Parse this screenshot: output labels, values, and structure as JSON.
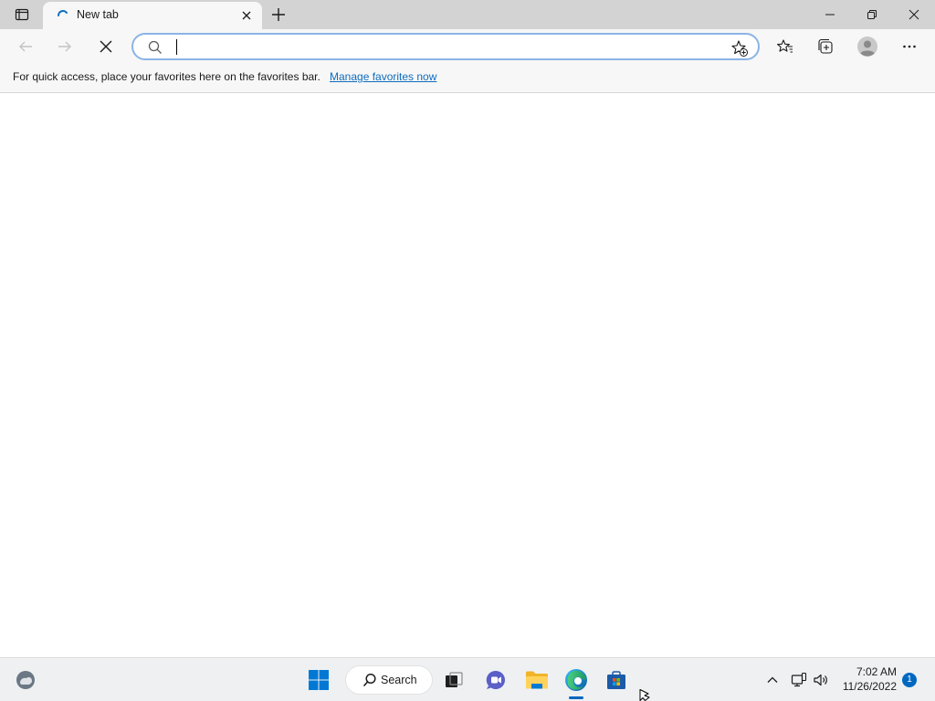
{
  "browser": {
    "tab": {
      "title": "New tab"
    },
    "address_bar": {
      "value": "",
      "placeholder": ""
    },
    "favorites_bar": {
      "message": "For quick access, place your favorites here on the favorites bar.",
      "link_label": "Manage favorites now"
    }
  },
  "taskbar": {
    "search_label": "Search",
    "clock": {
      "time": "7:02 AM",
      "date": "11/26/2022"
    },
    "notification_count": "1"
  },
  "icons": {
    "tab_actions": "tab-actions-icon",
    "tab_loading": "loading-spinner-icon",
    "close": "close-icon",
    "new_tab": "plus-icon",
    "minimize": "minimize-icon",
    "restore": "restore-icon",
    "window_close": "close-icon",
    "back": "back-arrow-icon",
    "forward": "forward-arrow-icon",
    "stop": "stop-icon",
    "search": "search-icon",
    "add_favorite": "star-add-icon",
    "favorites": "favorites-icon",
    "collections": "collections-icon",
    "profile": "profile-icon",
    "more": "more-icon",
    "weather": "weather-icon",
    "start": "windows-start-icon",
    "task_view": "task-view-icon",
    "chat": "chat-icon",
    "file_explorer": "folder-icon",
    "edge": "edge-icon",
    "store": "store-icon",
    "tray_chevron": "chevron-up-icon",
    "network": "network-icon",
    "volume": "volume-icon"
  },
  "colors": {
    "accent": "#0067c0",
    "link": "#0f6cbd",
    "address_focus": "#8ab4e6"
  }
}
